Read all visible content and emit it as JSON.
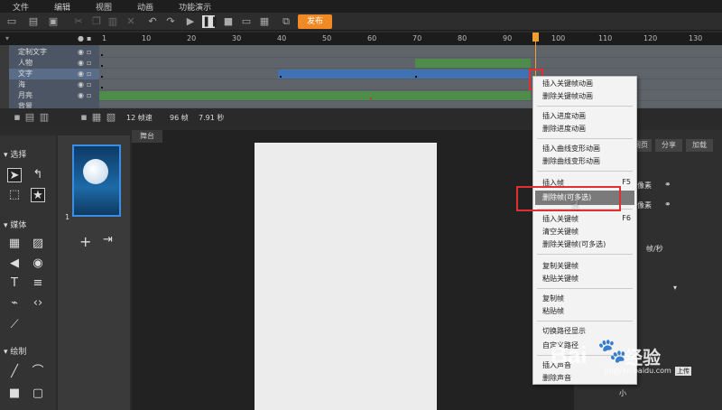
{
  "menubar": {
    "items": [
      "文件",
      "编辑",
      "视图",
      "动画",
      "功能演示"
    ]
  },
  "toolbar": {
    "publish_label": "发布"
  },
  "ruler": {
    "ticks": [
      "1",
      "10",
      "20",
      "30",
      "40",
      "50",
      "60",
      "70",
      "80",
      "90",
      "100",
      "110",
      "120",
      "130"
    ]
  },
  "layers": [
    {
      "name": "定制文字",
      "selected": false
    },
    {
      "name": "人物",
      "selected": false
    },
    {
      "name": "文字",
      "selected": true
    },
    {
      "name": "海",
      "selected": false
    },
    {
      "name": "月亮",
      "selected": false
    },
    {
      "name": "背景",
      "selected": false
    }
  ],
  "status": {
    "fps": "12 帧速",
    "frames": "96 帧",
    "seconds": "7.91 秒"
  },
  "panels": {
    "select_title": "选择",
    "media_title": "媒体",
    "draw_title": "绘制",
    "thumb_number": "1",
    "stage_tab": "舞台"
  },
  "right_tabs": [
    "网页",
    "分享",
    "加载"
  ],
  "right_fields": {
    "label1": "像素",
    "label2": "像素",
    "fps_unit": "帧/秒",
    "upload": "上传",
    "mini": "小"
  },
  "context_menu": {
    "groups": [
      [
        {
          "label": "插入关键帧动画"
        },
        {
          "label": "删除关键帧动画"
        }
      ],
      [
        {
          "label": "插入进度动画"
        },
        {
          "label": "删除进度动画"
        }
      ],
      [
        {
          "label": "插入曲线变形动画"
        },
        {
          "label": "删除曲线变形动画"
        }
      ],
      [
        {
          "label": "插入帧",
          "shortcut": "F5"
        },
        {
          "label": "删除帧(可多选)"
        }
      ],
      [
        {
          "label": "插入关键帧",
          "shortcut": "F6"
        },
        {
          "label": "清空关键帧"
        },
        {
          "label": "删除关键帧(可多选)"
        }
      ],
      [
        {
          "label": "复制关键帧"
        },
        {
          "label": "粘贴关键帧"
        }
      ],
      [
        {
          "label": "复制帧"
        },
        {
          "label": "粘贴帧"
        }
      ],
      [
        {
          "label": "切换路径显示"
        },
        {
          "label": "自定义路径"
        }
      ],
      [
        {
          "label": "插入声音"
        },
        {
          "label": "删除声音"
        }
      ]
    ],
    "hovered": "删除帧(可多选)"
  },
  "watermark": {
    "brand": "Bai",
    "suffix": "经验",
    "url": "jingyan.baidu.com"
  }
}
